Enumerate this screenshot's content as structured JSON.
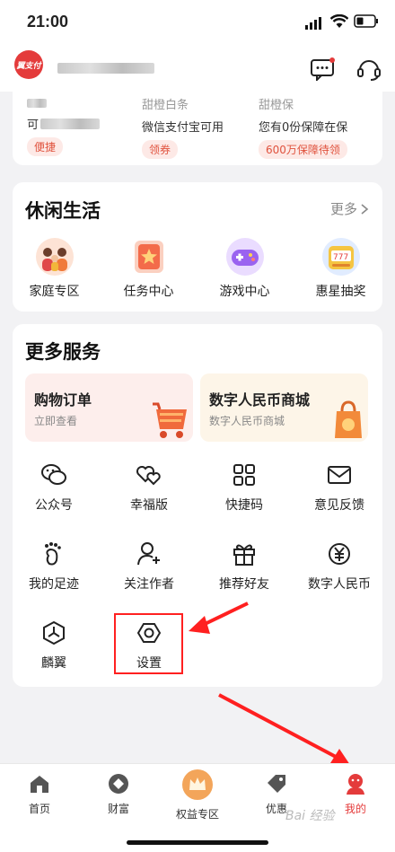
{
  "status": {
    "time": "21:00"
  },
  "header": {
    "logo_text": "翼支付"
  },
  "top_card": {
    "items": [
      {
        "title": "",
        "sub": "可",
        "pill": "便捷"
      },
      {
        "title": "甜橙白条",
        "sub": "微信支付宝可用",
        "pill": "领券"
      },
      {
        "title": "甜橙保",
        "sub": "您有0份保障在保",
        "pill": "600万保障待领"
      }
    ]
  },
  "leisure": {
    "title": "休闲生活",
    "more": "更多",
    "items": [
      {
        "label": "家庭专区",
        "icon": "family-icon"
      },
      {
        "label": "任务中心",
        "icon": "task-icon"
      },
      {
        "label": "游戏中心",
        "icon": "game-icon"
      },
      {
        "label": "惠星抽奖",
        "icon": "lottery-icon"
      }
    ]
  },
  "services": {
    "title": "更多服务",
    "banners": [
      {
        "title": "购物订单",
        "sub": "立即查看"
      },
      {
        "title": "数字人民币商城",
        "sub": "数字人民币商城"
      }
    ],
    "items": [
      {
        "label": "公众号",
        "icon": "wechat-icon"
      },
      {
        "label": "幸福版",
        "icon": "hearts-icon"
      },
      {
        "label": "快捷码",
        "icon": "qr-grid-icon"
      },
      {
        "label": "意见反馈",
        "icon": "mail-icon"
      },
      {
        "label": "我的足迹",
        "icon": "footprint-icon"
      },
      {
        "label": "关注作者",
        "icon": "follow-user-icon"
      },
      {
        "label": "推荐好友",
        "icon": "gift-icon"
      },
      {
        "label": "数字人民币",
        "icon": "yuan-icon"
      },
      {
        "label": "麟翼",
        "icon": "hexagon-y-icon"
      },
      {
        "label": "设置",
        "icon": "settings-icon"
      }
    ]
  },
  "tabs": [
    {
      "label": "首页",
      "icon": "home-icon"
    },
    {
      "label": "财富",
      "icon": "wealth-icon"
    },
    {
      "label": "权益专区",
      "icon": "crown-icon"
    },
    {
      "label": "优惠",
      "icon": "tag-icon"
    },
    {
      "label": "我的",
      "icon": "profile-icon"
    }
  ],
  "watermark": "Bai 经验",
  "colors": {
    "accent": "#e43b3b",
    "pill_text": "#e0533e",
    "annotation": "#ff2020"
  }
}
